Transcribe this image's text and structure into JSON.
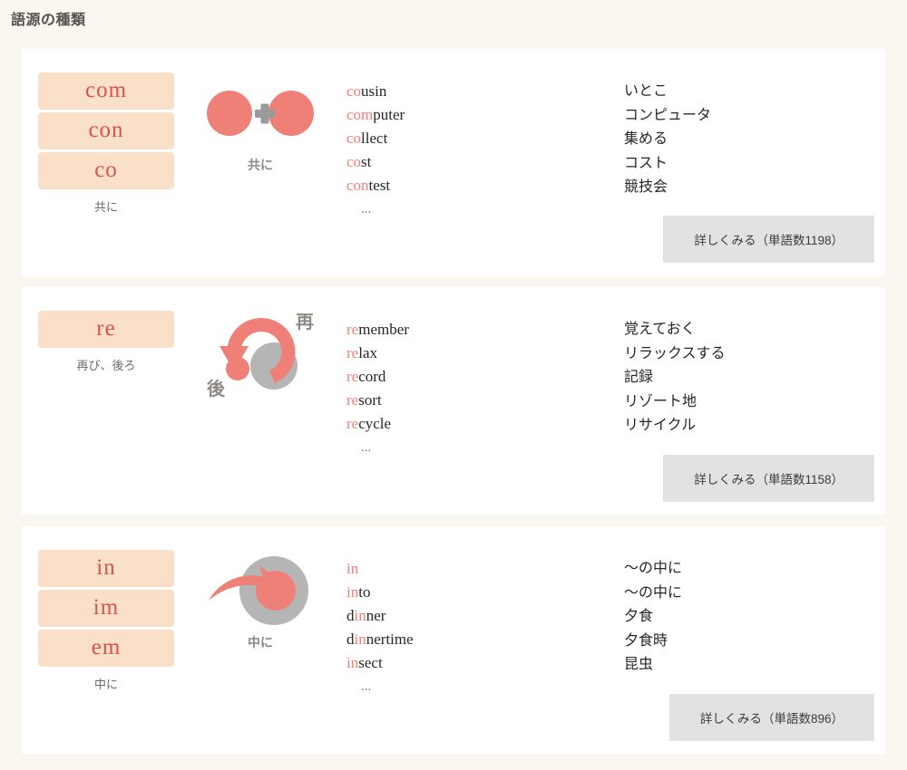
{
  "header": {
    "title": "語源の種類"
  },
  "colors": {
    "page_background": "#f9f7ef",
    "card_background": "#ffffff",
    "tag_background": "#fae0c8",
    "tag_text": "#d9534f",
    "accent_salmon": "#ee8077",
    "icon_gray": "#b5b5b5",
    "button_background": "#e2e2e2"
  },
  "cards": [
    {
      "tags": [
        "com",
        "con",
        "co"
      ],
      "tag_meaning": "共に",
      "icon": {
        "name": "two-circles-plus-icon",
        "label": "共に"
      },
      "words": [
        {
          "prefix": "co",
          "rest": "usin",
          "meaning": "いとこ"
        },
        {
          "prefix": "com",
          "rest": "puter",
          "meaning": "コンピュータ"
        },
        {
          "prefix": "co",
          "rest": "llect",
          "meaning": "集める"
        },
        {
          "prefix": "co",
          "rest": "st",
          "meaning": "コスト"
        },
        {
          "prefix": "con",
          "rest": "test",
          "meaning": "競技会"
        }
      ],
      "ellipsis": "...",
      "button_label": "詳しくみる（単語数1198）",
      "word_count": 1198
    },
    {
      "tags": [
        "re"
      ],
      "tag_meaning": "再び、後ろ",
      "icon": {
        "name": "circular-arrow-back-icon",
        "label_top": "再",
        "label_bottom": "後"
      },
      "words": [
        {
          "prefix": "re",
          "rest": "member",
          "meaning": "覚えておく"
        },
        {
          "prefix": "re",
          "rest": "lax",
          "meaning": "リラックスする"
        },
        {
          "prefix": "re",
          "rest": "cord",
          "meaning": "記録"
        },
        {
          "prefix": "re",
          "rest": "sort",
          "meaning": "リゾート地"
        },
        {
          "prefix": "re",
          "rest": "cycle",
          "meaning": "リサイクル"
        }
      ],
      "ellipsis": "...",
      "button_label": "詳しくみる（単語数1158）",
      "word_count": 1158
    },
    {
      "tags": [
        "in",
        "im",
        "em"
      ],
      "tag_meaning": "中に",
      "icon": {
        "name": "arrow-into-circle-icon",
        "label": "中に"
      },
      "words": [
        {
          "pre": "",
          "prefix": "in",
          "rest": "",
          "meaning": "〜の中に"
        },
        {
          "pre": "",
          "prefix": "in",
          "rest": "to",
          "meaning": "〜の中に"
        },
        {
          "pre": "d",
          "prefix": "in",
          "rest": "ner",
          "meaning": "夕食"
        },
        {
          "pre": "d",
          "prefix": "in",
          "rest": "nertime",
          "meaning": "夕食時"
        },
        {
          "pre": "",
          "prefix": "in",
          "rest": "sect",
          "meaning": "昆虫"
        }
      ],
      "ellipsis": "...",
      "button_label": "詳しくみる（単語数896）",
      "word_count": 896
    }
  ]
}
